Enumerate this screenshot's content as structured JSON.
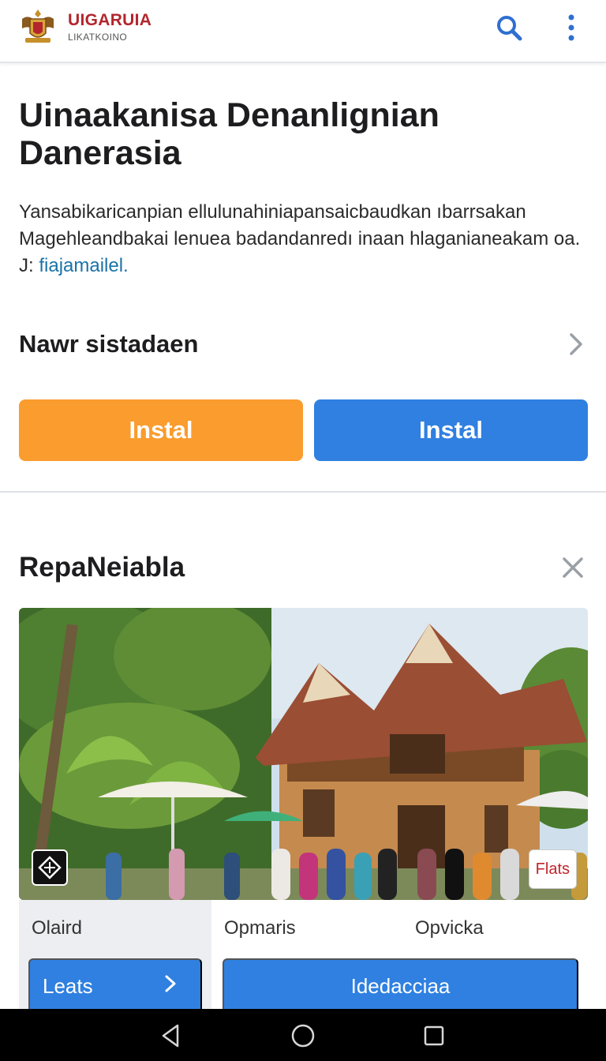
{
  "header": {
    "brand_name": "UIGARUIA",
    "brand_sub": "LIKATKOINO",
    "logo_icon": "emblem-logo",
    "search_icon": "search-icon",
    "more_icon": "more-vert-icon",
    "accent_color": "#2f6fd0"
  },
  "intro": {
    "title": "Uinaakanisa Denanlignian Danerasia",
    "description": "Yansabikaricanpian ellulunahiniapansaicbaudkan ıbarrsakan Magehleandbakai lenuea badandanredı inaan hlaganianeakam oa. J:",
    "description_link": "fiajamailel."
  },
  "section1": {
    "title": "Nawr sistadaen",
    "buttons": [
      {
        "label": "Instal",
        "color": "#fa9c2e"
      },
      {
        "label": "Instal",
        "color": "#2f80e0"
      }
    ]
  },
  "section2": {
    "title": "RepaNeiabla",
    "close_icon": "close-icon",
    "photo_badge_right": "Flats",
    "cards": {
      "left": {
        "label": "Olaird",
        "button": "Leats"
      },
      "right": {
        "label1": "Opmaris",
        "label2": "Opvicka",
        "button": "Idedacciaa"
      }
    }
  },
  "nav": {
    "back_icon": "back-triangle-icon",
    "home_icon": "home-circle-icon",
    "recents_icon": "recents-square-icon"
  }
}
